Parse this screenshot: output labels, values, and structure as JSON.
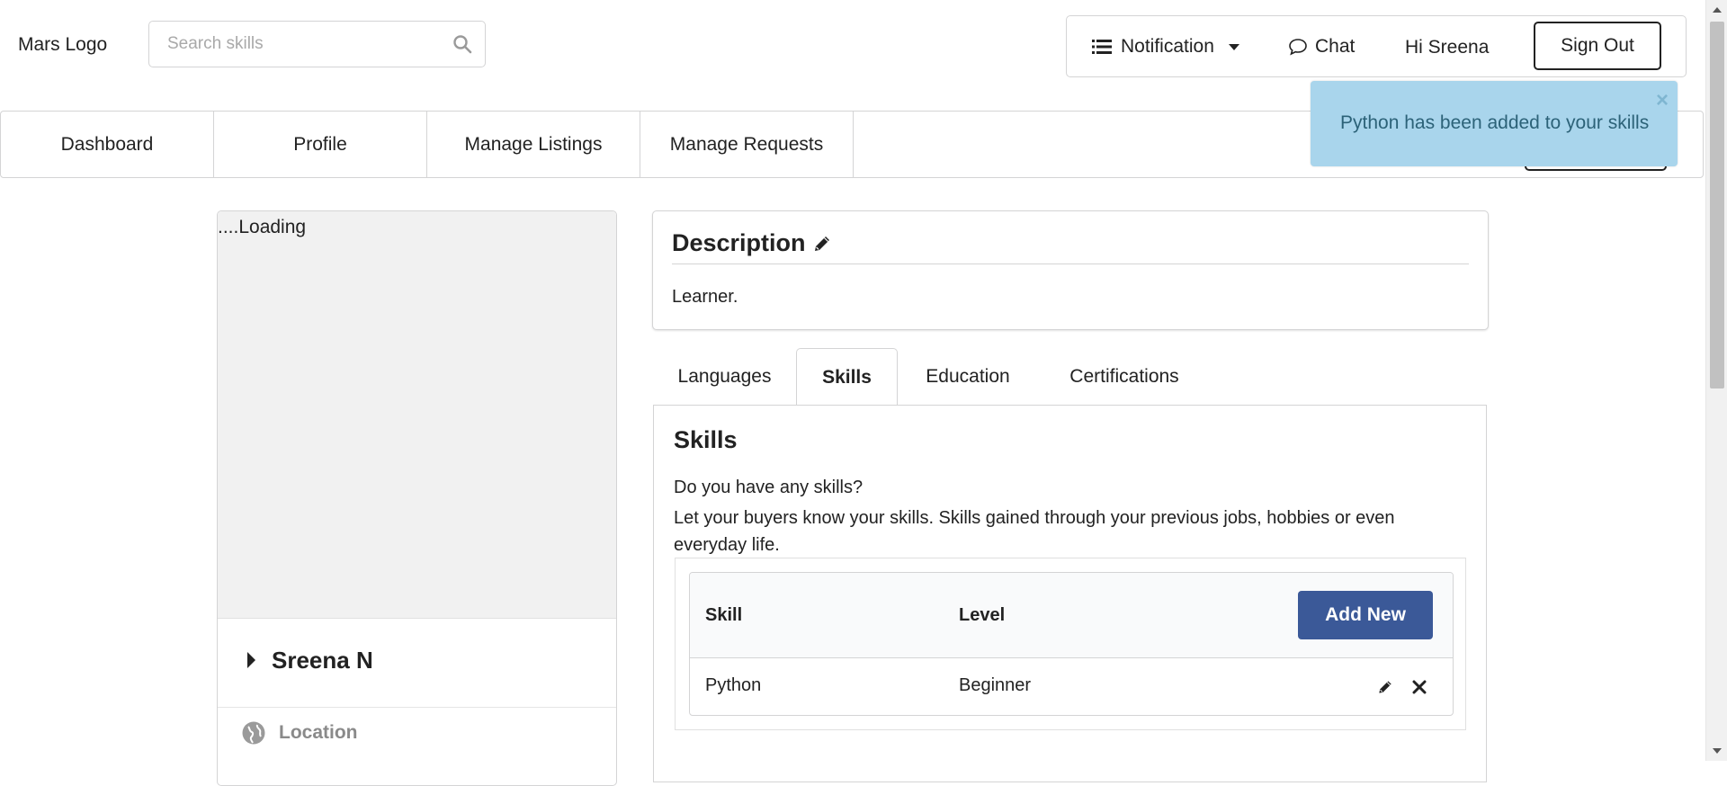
{
  "header": {
    "logo": "Mars Logo",
    "search_placeholder": "Search skills",
    "notification_label": "Notification",
    "chat_label": "Chat",
    "greeting": "Hi Sreena",
    "signout_label": "Sign Out"
  },
  "nav": {
    "tabs": [
      "Dashboard",
      "Profile",
      "Manage Listings",
      "Manage Requests"
    ]
  },
  "toast": {
    "message": "Python has been added to your skills",
    "close": "×"
  },
  "profile_card": {
    "image_alt": "....Loading",
    "name": "Sreena N",
    "location_label": "Location"
  },
  "description": {
    "title": "Description",
    "text": "Learner."
  },
  "profile_tabs": [
    "Languages",
    "Skills",
    "Education",
    "Certifications"
  ],
  "active_tab": "Skills",
  "skills_panel": {
    "title": "Skills",
    "question": "Do you have any skills?",
    "explanation": "Let your buyers know your skills. Skills gained through your previous jobs, hobbies or even everyday life.",
    "col_skill": "Skill",
    "col_level": "Level",
    "add_new": "Add New",
    "rows": [
      {
        "skill": "Python",
        "level": "Beginner"
      }
    ]
  },
  "colors": {
    "accent": "#3b5998",
    "toast_bg": "#a9d5ec",
    "toast_text": "#2c6278"
  }
}
